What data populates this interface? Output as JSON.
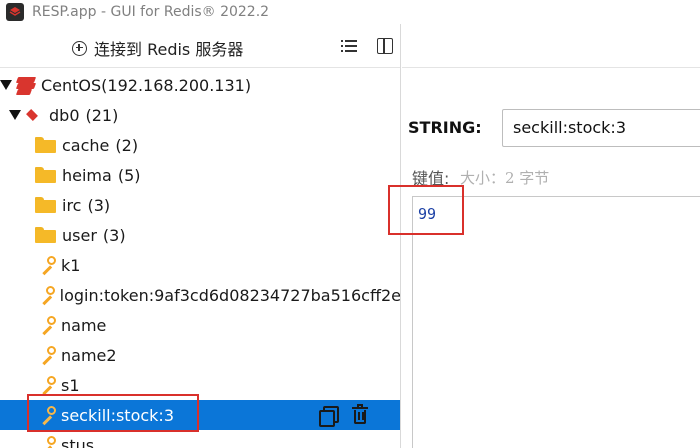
{
  "window": {
    "title": "RESP.app - GUI for Redis® 2022.2"
  },
  "toolbar": {
    "connect_label": "连接到 Redis 服务器"
  },
  "tree": {
    "server": {
      "label": "CentOS(192.168.200.131)"
    },
    "db": {
      "name": "db0",
      "count": "(21)"
    },
    "folders": [
      {
        "name": "cache",
        "count": "(2)"
      },
      {
        "name": "heima",
        "count": "(5)"
      },
      {
        "name": "irc",
        "count": "(3)"
      },
      {
        "name": "user",
        "count": "(3)"
      }
    ],
    "keys": [
      "k1",
      "login:token:9af3cd6d08234727ba516cff2e",
      "name",
      "name2",
      "s1"
    ],
    "selected_key": "seckill:stock:3",
    "partial_key": "stus"
  },
  "editor": {
    "type_label": "STRING:",
    "key_name": "seckill:stock:3",
    "value_label": "键值:",
    "size_label": "大小：2 字节",
    "value": "99"
  },
  "colors": {
    "accent": "#0b76d8",
    "highlight": "#d9302b",
    "redis_red": "#d9352e",
    "key_orange": "#f5a623",
    "folder_yellow": "#f5b928"
  }
}
